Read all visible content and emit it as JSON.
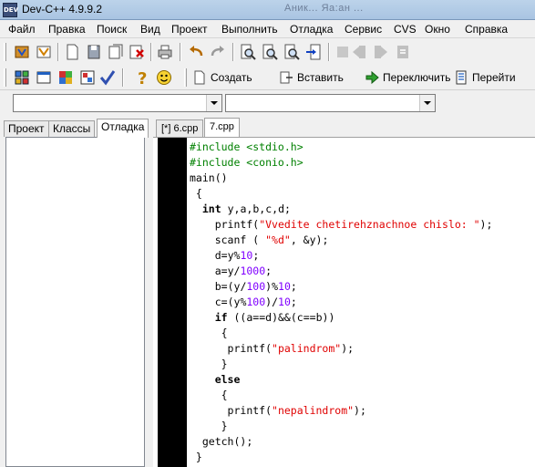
{
  "window": {
    "title": "Dev-C++ 4.9.9.2",
    "icon": "devcpp-icon",
    "background_tabs": "Аник...  Яа:ан ..."
  },
  "menu": [
    "Файл",
    "Правка",
    "Поиск",
    "Вид",
    "Проект",
    "Выполнить",
    "Отладка",
    "Сервис",
    "CVS",
    "Окно",
    "Справка"
  ],
  "toolbar2": {
    "create": "Создать",
    "insert": "Вставить",
    "toggle": "Переключить",
    "goto": "Перейти"
  },
  "left_tabs": [
    "Проект",
    "Классы",
    "Отладка"
  ],
  "editor_tabs": [
    "[*] 6.cpp",
    "7.cpp"
  ],
  "code": [
    "#include <stdio.h>",
    "#include <conio.h>",
    "main()",
    " {",
    "  int y,a,b,c,d;",
    "    printf(\"Vvedite chetirehznachnoe chislo: \");",
    "    scanf ( \"%d\", &y);",
    "    d=y%10;",
    "    a=y/1000;",
    "    b=(y/100)%10;",
    "    c=(y%100)/10;",
    "    if ((a==d)&&(c==b))",
    "     {",
    "      printf(\"palindrom\");",
    "     }",
    "    else",
    "     {",
    "      printf(\"nepalindrom\");",
    "     }",
    "  getch();",
    " }"
  ],
  "colors": {
    "preprocessor": "#008000",
    "string": "#e00000",
    "number": "#8000ff",
    "gutter": "#000000"
  }
}
